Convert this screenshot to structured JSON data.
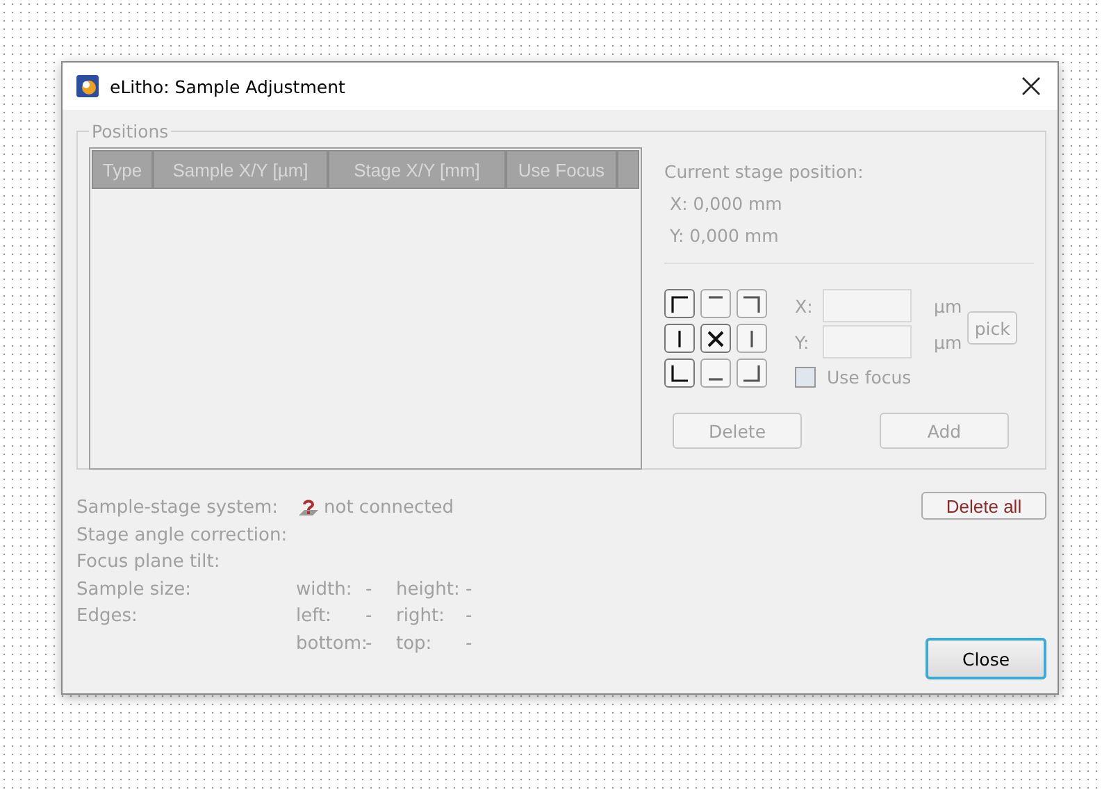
{
  "window": {
    "title": "eLitho: Sample Adjustment"
  },
  "positions": {
    "title": "Positions",
    "table": {
      "columns": [
        "Type",
        "Sample X/Y [µm]",
        "Stage X/Y [mm]",
        "Use Focus"
      ]
    },
    "current": {
      "label": "Current stage position:",
      "x": "X: 0,000 mm",
      "y": "Y: 0,000 mm"
    },
    "nav_buttons": [
      {
        "disabled": false
      },
      {
        "disabled": true
      },
      {
        "disabled": true
      },
      {
        "disabled": false
      },
      {
        "disabled": false
      },
      {
        "disabled": true
      },
      {
        "disabled": false
      },
      {
        "disabled": true
      },
      {
        "disabled": true
      }
    ],
    "x_field": {
      "label": "X:",
      "unit": "µm",
      "disabled": true
    },
    "y_field": {
      "label": "Y:",
      "unit": "µm",
      "disabled": true
    },
    "pick": {
      "label": "pick",
      "disabled": true
    },
    "use_focus": {
      "label": "Use focus",
      "checked": false,
      "disabled": true
    },
    "delete": {
      "label": "Delete",
      "disabled": true
    },
    "add": {
      "label": "Add",
      "disabled": true
    }
  },
  "info": {
    "system_label": "Sample-stage system:",
    "system_value": "not connected",
    "angle_label": "Stage angle correction:",
    "tilt_label": "Focus plane tilt:",
    "size_label": "Sample size:",
    "width_label": "width:",
    "width_value": "-",
    "height_label": "height:",
    "height_value": "-",
    "edges_label": "Edges:",
    "left_label": "left:",
    "left_value": "-",
    "right_label": "right:",
    "right_value": "-",
    "bottom_label": "bottom:",
    "bottom_value": "-",
    "top_label": "top:",
    "top_value": "-"
  },
  "delete_all": {
    "label": "Delete all"
  },
  "close": {
    "label": "Close",
    "default": true
  }
}
